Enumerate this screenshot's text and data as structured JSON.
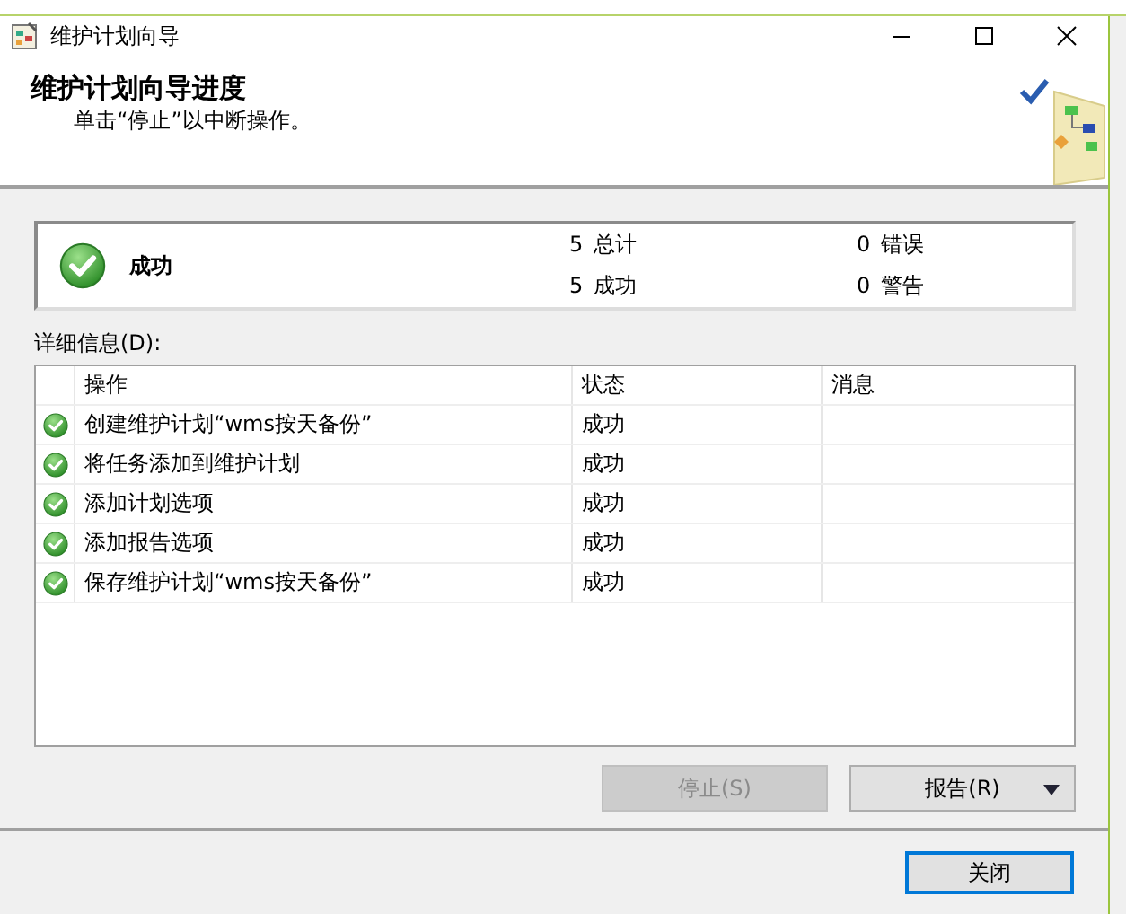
{
  "window": {
    "title": "维护计划向导"
  },
  "header": {
    "title": "维护计划向导进度",
    "subtitle": "单击“停止”以中断操作。"
  },
  "summary": {
    "status": "成功",
    "counts": [
      {
        "value": "5",
        "label": "总计"
      },
      {
        "value": "0",
        "label": "错误"
      },
      {
        "value": "5",
        "label": "成功"
      },
      {
        "value": "0",
        "label": "警告"
      }
    ]
  },
  "details": {
    "label": "详细信息(D):",
    "columns": [
      "操作",
      "状态",
      "消息"
    ],
    "rows": [
      {
        "action": "创建维护计划“wms按天备份”",
        "status": "成功",
        "success": true
      },
      {
        "action": "将任务添加到维护计划",
        "status": "成功",
        "success": true
      },
      {
        "action": "添加计划选项",
        "status": "成功",
        "success": true
      },
      {
        "action": "添加报告选项",
        "status": "成功",
        "success": true
      },
      {
        "action": "保存维护计划“wms按天备份”",
        "status": "成功",
        "success": true
      }
    ]
  },
  "buttons": [
    {
      "kind": "stop",
      "label": "停止(S)",
      "disabled": true
    },
    {
      "kind": "report",
      "label": "报告(R)",
      "disabled": false
    }
  ],
  "close_button": {
    "label": "关闭",
    "focused": true
  }
}
